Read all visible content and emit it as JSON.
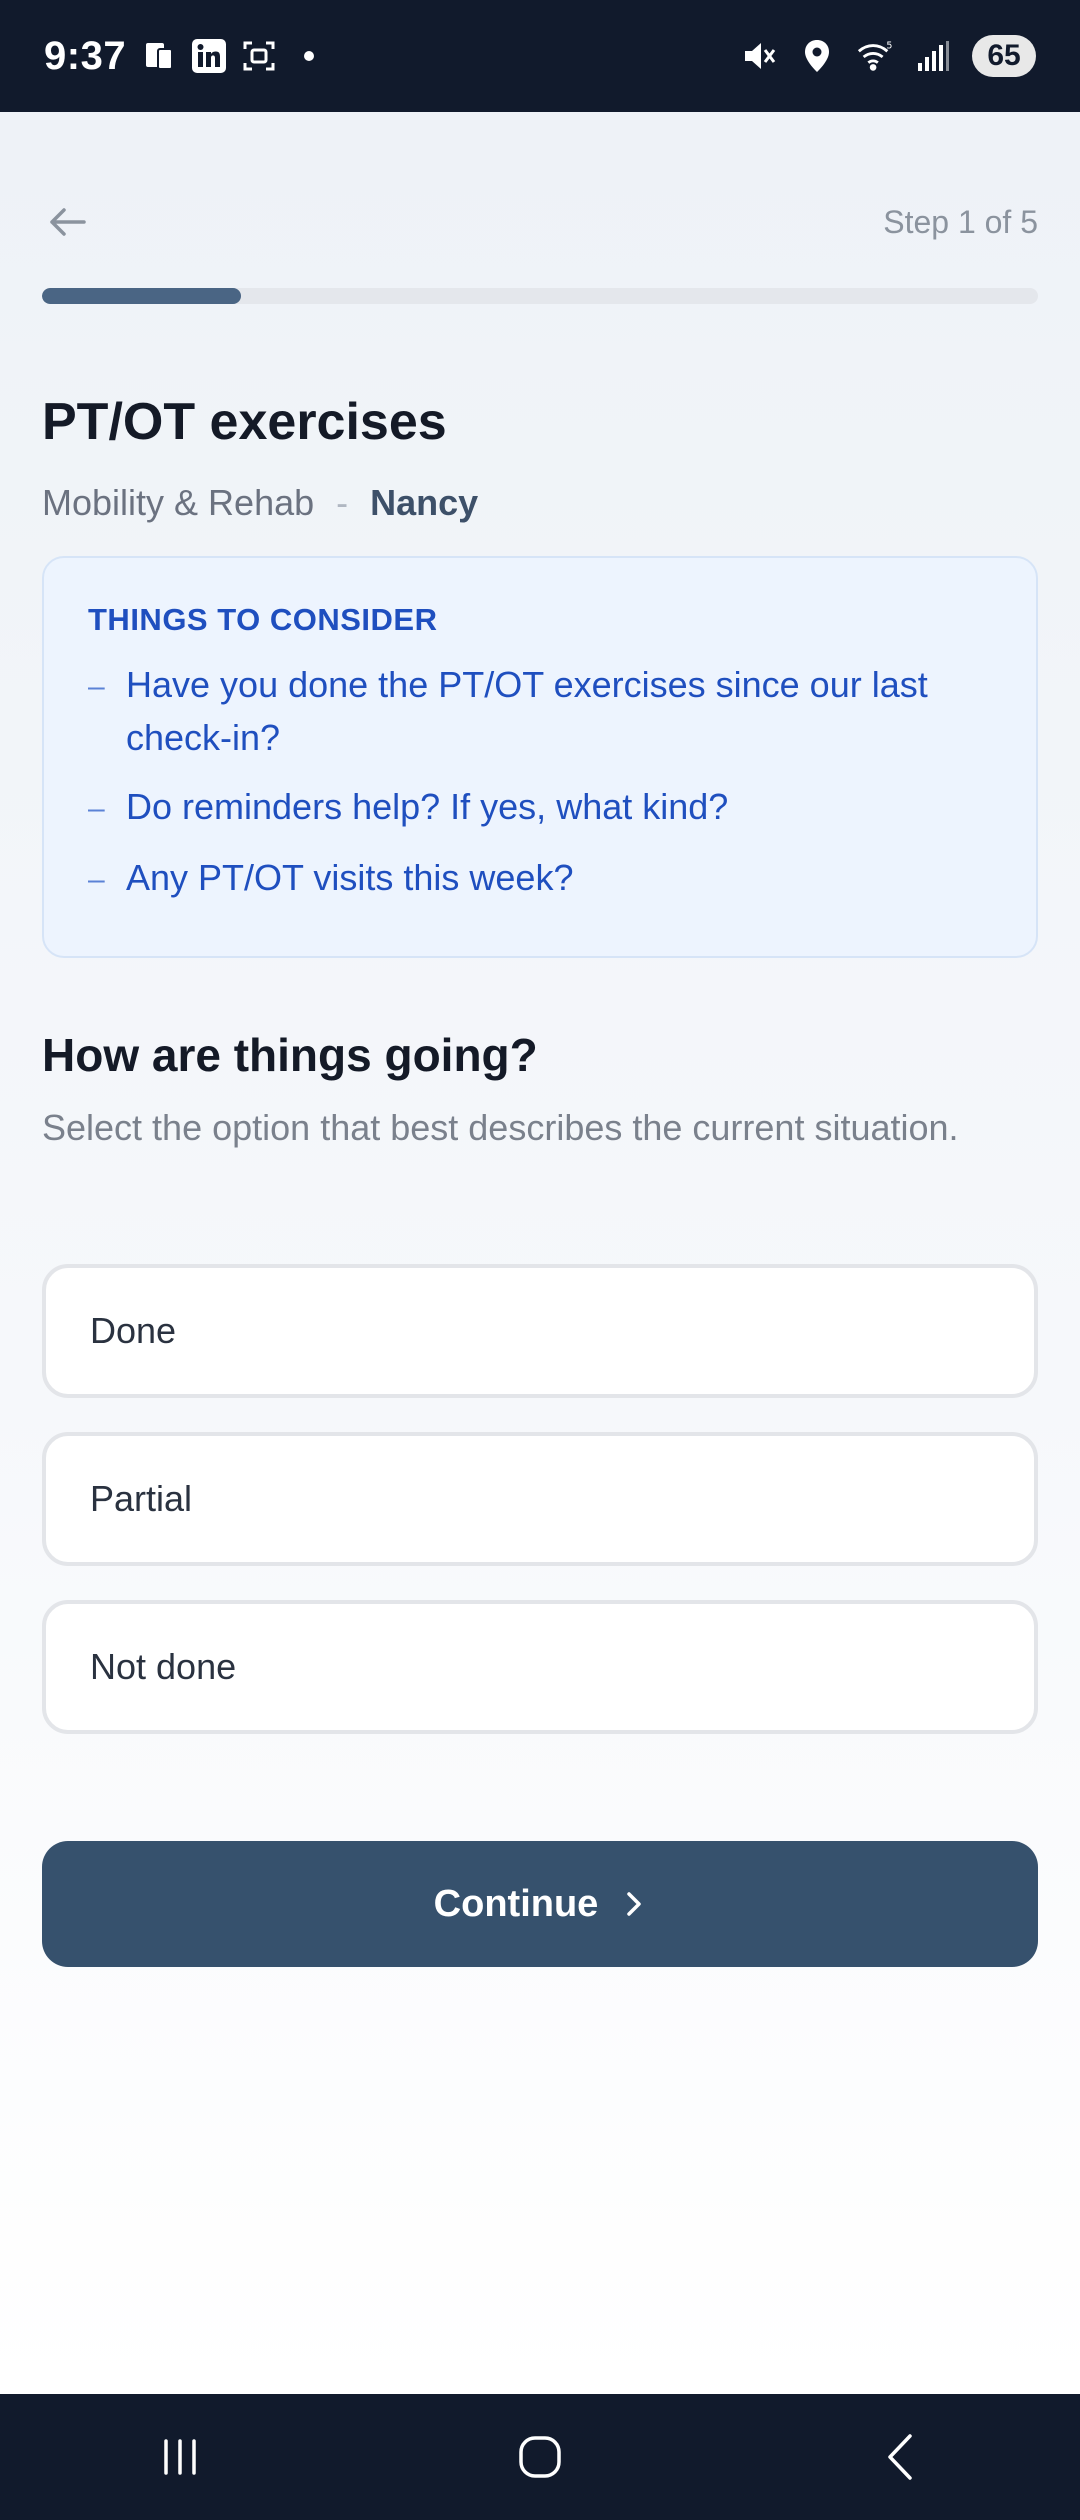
{
  "status_bar": {
    "time": "9:37",
    "battery": "65",
    "left_icons": [
      "phone-notification-icon",
      "linkedin-icon",
      "screenshot-icon",
      "dot-icon"
    ],
    "right_icons": [
      "mute-icon",
      "location-icon",
      "wifi-icon",
      "signal-icon"
    ]
  },
  "header": {
    "step_label": "Step 1 of 5",
    "progress_fraction": 0.2
  },
  "task": {
    "title": "PT/OT exercises",
    "category": "Mobility & Rehab",
    "separator": "-",
    "person": "Nancy"
  },
  "consider": {
    "title": "THINGS TO CONSIDER",
    "items": [
      "Have you done the PT/OT exercises since our last check-in?",
      "Do reminders help? If yes, what kind?",
      "Any PT/OT visits this week?"
    ]
  },
  "question": {
    "title": "How are things going?",
    "help": "Select the option that best describes the current situation.",
    "options": [
      "Done",
      "Partial",
      "Not done"
    ]
  },
  "continue_label": "Continue",
  "colors": {
    "accent": "#36516d",
    "progress": "#4a6584",
    "consider_text": "#1f4fbf",
    "consider_bg": "#edf4fe",
    "status_bar": "#111a2c"
  }
}
